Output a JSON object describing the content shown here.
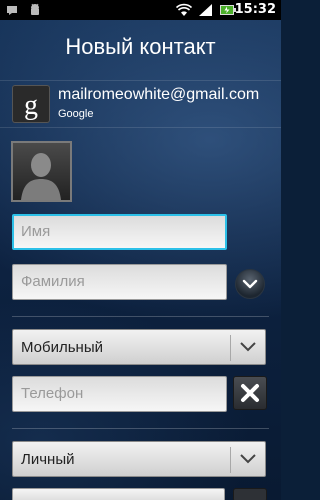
{
  "status_bar": {
    "time": "15:32",
    "icons": [
      "message-icon",
      "android-debug-icon",
      "wifi-icon",
      "signal-icon",
      "battery-charging-icon"
    ]
  },
  "header": {
    "title": "Новый контакт"
  },
  "account": {
    "email": "mailromeowhite@gmail.com",
    "type": "Google",
    "icon": "google-icon"
  },
  "photo": {
    "icon": "contact-silhouette-icon"
  },
  "name_fields": {
    "first_name_placeholder": "Имя",
    "last_name_placeholder": "Фамилия"
  },
  "phone": {
    "type_label": "Мобильный",
    "placeholder": "Телефон"
  },
  "email_section": {
    "type_label": "Личный"
  },
  "colors": {
    "focus_border": "#2cc0e8",
    "background": "#0e2444"
  }
}
